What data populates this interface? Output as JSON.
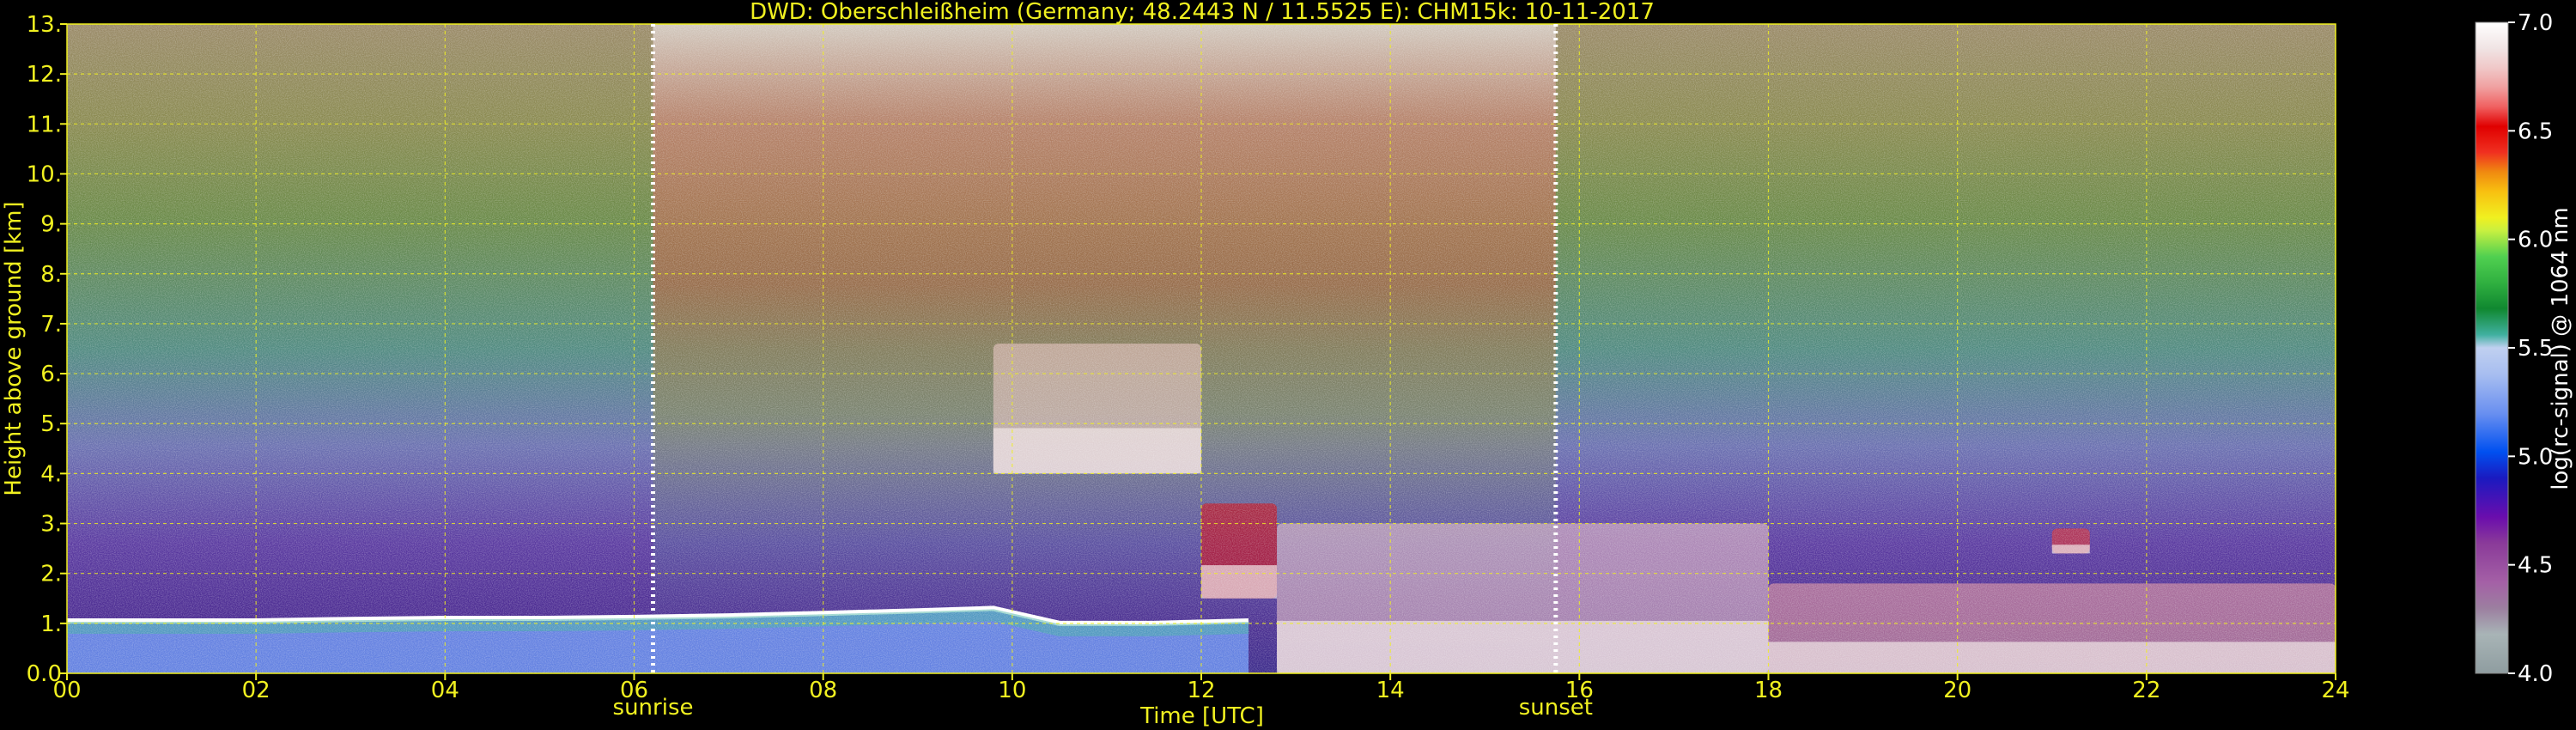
{
  "chart_data": {
    "type": "heatmap",
    "title": "DWD: Oberschleißheim (Germany; 48.2443 N / 11.5525 E):    CHM15k: 10-11-2017",
    "xlabel": "Time [UTC]",
    "ylabel": "Height above ground [km]",
    "x_ticks": [
      "00",
      "02",
      "04",
      "06",
      "08",
      "10",
      "12",
      "14",
      "16",
      "18",
      "20",
      "22",
      "24"
    ],
    "x_tick_values": [
      0,
      2,
      4,
      6,
      8,
      10,
      12,
      14,
      16,
      18,
      20,
      22,
      24
    ],
    "y_ticks": [
      "0.0",
      "1.",
      "2.",
      "3.",
      "4.",
      "5.",
      "6.",
      "7.",
      "8.",
      "9.",
      "10.",
      "11.",
      "12.",
      "13."
    ],
    "y_tick_values": [
      0,
      1,
      2,
      3,
      4,
      5,
      6,
      7,
      8,
      9,
      10,
      11,
      12,
      13
    ],
    "xlim": [
      0,
      24
    ],
    "ylim": [
      0,
      13
    ],
    "grid": true,
    "markers": [
      {
        "label": "sunrise",
        "time": 6.2
      },
      {
        "label": "sunset",
        "time": 15.75
      }
    ],
    "colorbar": {
      "label": "log(rc-signal) @ 1064 nm",
      "range": [
        4.0,
        7.0
      ],
      "ticks": [
        "4.0",
        "4.5",
        "5.0",
        "5.5",
        "6.0",
        "6.5",
        "7.0"
      ],
      "tick_values": [
        4.0,
        4.5,
        5.0,
        5.5,
        6.0,
        6.5,
        7.0
      ],
      "colors": [
        "#8f9da0",
        "#a8b4b6",
        "#9c7fa0",
        "#a460a6",
        "#8a3a99",
        "#6a0dad",
        "#5a00b0",
        "#1a1ac0",
        "#0050f0",
        "#3a78f0",
        "#6a90f0",
        "#8aa8f0",
        "#a8bef0",
        "#c0d0f0",
        "#40b0a0",
        "#20a060",
        "#108830",
        "#30b040",
        "#50d050",
        "#90e040",
        "#c8f040",
        "#f0f020",
        "#f8c010",
        "#f08a10",
        "#f06020",
        "#f03020",
        "#e00000",
        "#f06060",
        "#f0a0a0",
        "#f0c8c8",
        "#f0e4e4",
        "#ffffff"
      ]
    },
    "boundary_layer_top_km": [
      [
        0.0,
        1.05
      ],
      [
        1.0,
        1.05
      ],
      [
        2.0,
        1.05
      ],
      [
        3.0,
        1.08
      ],
      [
        4.0,
        1.1
      ],
      [
        5.0,
        1.1
      ],
      [
        6.0,
        1.12
      ],
      [
        7.0,
        1.15
      ],
      [
        8.0,
        1.2
      ],
      [
        9.0,
        1.25
      ],
      [
        9.8,
        1.3
      ],
      [
        10.5,
        1.0
      ],
      [
        11.5,
        1.0
      ],
      [
        12.5,
        1.05
      ]
    ],
    "cloud_features": [
      {
        "x": [
          9.8,
          12.0
        ],
        "y": [
          4.0,
          6.6
        ],
        "value": 6.8
      },
      {
        "x": [
          12.0,
          12.8
        ],
        "y": [
          1.5,
          3.4
        ],
        "value": 6.5
      },
      {
        "x": [
          12.8,
          18.0
        ],
        "y": [
          0.0,
          3.0
        ],
        "value": 6.8
      },
      {
        "x": [
          18.0,
          24.0
        ],
        "y": [
          0.0,
          1.8
        ],
        "value": 6.7
      },
      {
        "x": [
          21.0,
          21.4
        ],
        "y": [
          2.4,
          2.9
        ],
        "value": 6.4
      }
    ]
  }
}
